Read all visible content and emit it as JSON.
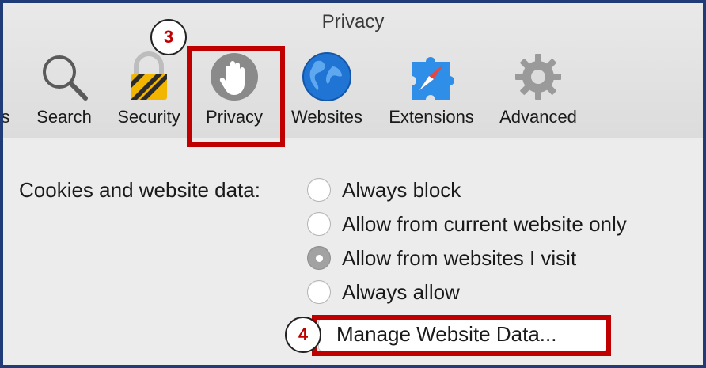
{
  "window": {
    "title": "Privacy"
  },
  "toolbar": {
    "items": [
      {
        "label": "s",
        "icon": "truncated-item"
      },
      {
        "label": "Search",
        "icon": "magnifier-icon"
      },
      {
        "label": "Security",
        "icon": "padlock-icon"
      },
      {
        "label": "Privacy",
        "icon": "hand-icon",
        "selected": true
      },
      {
        "label": "Websites",
        "icon": "globe-icon"
      },
      {
        "label": "Extensions",
        "icon": "compass-puzzle-icon"
      },
      {
        "label": "Advanced",
        "icon": "gear-icon"
      }
    ]
  },
  "cookies": {
    "label": "Cookies and website data:",
    "options": [
      {
        "label": "Always block",
        "checked": false
      },
      {
        "label": "Allow from current website only",
        "checked": false
      },
      {
        "label": "Allow from websites I visit",
        "checked": true
      },
      {
        "label": "Always allow",
        "checked": false
      }
    ],
    "manage_button": "Manage Website Data..."
  },
  "annotations": {
    "step3": "3",
    "step4": "4",
    "highlight_color": "#c00000"
  },
  "colors": {
    "frame_border": "#1f3c78",
    "background": "#ececec"
  }
}
